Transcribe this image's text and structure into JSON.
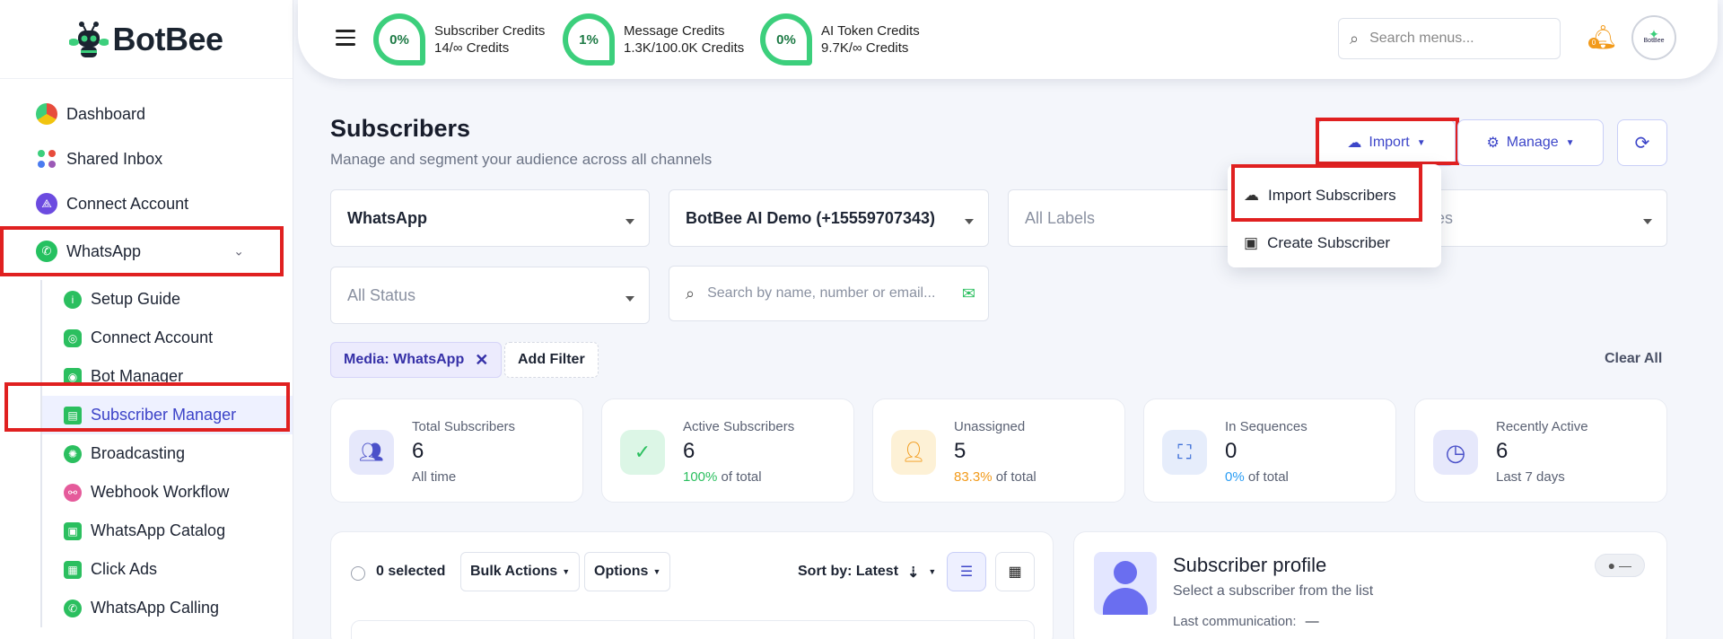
{
  "brand": {
    "name": "BotBee"
  },
  "sidebar": {
    "items": [
      {
        "label": "Dashboard",
        "icon": "dashboard-icon"
      },
      {
        "label": "Shared Inbox",
        "icon": "shared-inbox-icon"
      },
      {
        "label": "Connect Account",
        "icon": "connect-account-icon"
      },
      {
        "label": "WhatsApp",
        "icon": "whatsapp-icon"
      }
    ],
    "whatsapp_sub": [
      {
        "label": "Setup Guide",
        "icon": "info-icon"
      },
      {
        "label": "Connect Account",
        "icon": "whatsapp-connect-icon"
      },
      {
        "label": "Bot Manager",
        "icon": "bot-icon"
      },
      {
        "label": "Subscriber Manager",
        "icon": "subscriber-icon"
      },
      {
        "label": "Broadcasting",
        "icon": "broadcast-icon"
      },
      {
        "label": "Webhook Workflow",
        "icon": "webhook-icon"
      },
      {
        "label": "WhatsApp Catalog",
        "icon": "catalog-icon"
      },
      {
        "label": "Click Ads",
        "icon": "click-ads-icon"
      },
      {
        "label": "WhatsApp Calling",
        "icon": "calling-icon"
      }
    ]
  },
  "topbar": {
    "credits": [
      {
        "percent": "0%",
        "title": "Subscriber Credits",
        "detail": "14/∞ Credits"
      },
      {
        "percent": "1%",
        "title": "Message Credits",
        "detail": "1.3K/100.0K Credits"
      },
      {
        "percent": "0%",
        "title": "AI Token Credits",
        "detail": "9.7K/∞ Credits"
      }
    ],
    "search_placeholder": "Search menus...",
    "notification_count": "0",
    "avatar_text": "BotBee"
  },
  "page": {
    "title": "Subscribers",
    "subtitle": "Manage and segment your audience across all channels",
    "import_label": "Import",
    "manage_label": "Manage",
    "import_menu": [
      "Import Subscribers",
      "Create Subscriber"
    ]
  },
  "filters": {
    "channel": "WhatsApp",
    "account": "BotBee AI Demo (+15559707343)",
    "labels": "All Labels",
    "sequences_partial": "ces",
    "status": "All Status",
    "search_placeholder": "Search by name, number or email...",
    "active_chip": "Media: WhatsApp",
    "add_filter": "Add Filter",
    "clear_all": "Clear All"
  },
  "stats": [
    {
      "label": "Total Subscribers",
      "value": "6",
      "footer": "All time",
      "highlight": ""
    },
    {
      "label": "Active Subscribers",
      "value": "6",
      "footer": " of total",
      "highlight": "100%"
    },
    {
      "label": "Unassigned",
      "value": "5",
      "footer": " of total",
      "highlight": "83.3%"
    },
    {
      "label": "In Sequences",
      "value": "0",
      "footer": " of total",
      "highlight": "0%"
    },
    {
      "label": "Recently Active",
      "value": "6",
      "footer": "Last 7 days",
      "highlight": ""
    }
  ],
  "list": {
    "selected": "0 selected",
    "bulk_actions": "Bulk Actions",
    "options": "Options",
    "sort": "Sort by: Latest"
  },
  "profile": {
    "title": "Subscriber profile",
    "subtitle": "Select a subscriber from the list",
    "last_comm_label": "Last communication:",
    "last_comm_value": "—",
    "status_badge": "● —"
  },
  "colors": {
    "accent": "#3d46c9",
    "green": "#3ccf7c",
    "highlight_red": "#e02020",
    "orange": "#f29a1a"
  }
}
